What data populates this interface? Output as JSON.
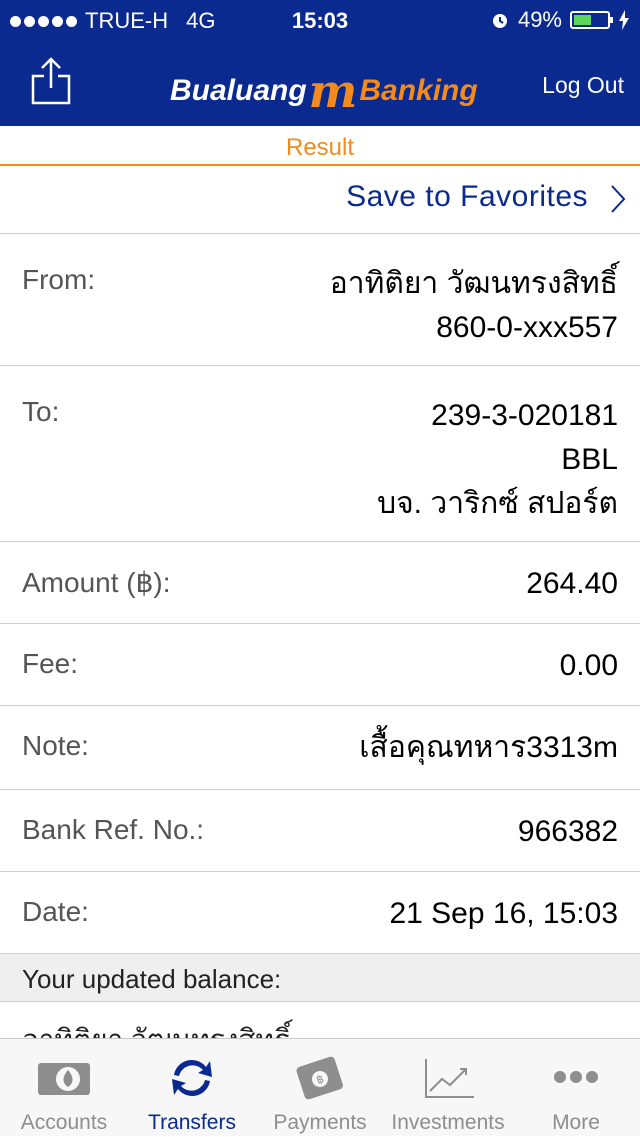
{
  "status_bar": {
    "carrier": "TRUE-H",
    "network": "4G",
    "time": "15:03",
    "battery": "49%"
  },
  "header": {
    "logo_part1": "Bualuang",
    "logo_m": "m",
    "logo_part2": "Banking",
    "logout_label": "Log Out"
  },
  "page_title": "Result",
  "favorites_label": "Save to Favorites",
  "details": [
    {
      "key": "From:",
      "lines": [
        "อาทิติยา วัฒนทรงสิทธิ์",
        "860-0-xxx557"
      ]
    },
    {
      "key": "To:",
      "lines": [
        "239-3-020181",
        "BBL",
        "บจ. วาริกซ์ สปอร์ต"
      ]
    },
    {
      "key": "Amount (฿):",
      "lines": [
        "264.40"
      ]
    },
    {
      "key": "Fee:",
      "lines": [
        "0.00"
      ]
    },
    {
      "key": "Note:",
      "lines": [
        "เสื้อคุณทหาร3313m"
      ]
    },
    {
      "key": "Bank Ref. No.:",
      "lines": [
        "966382"
      ]
    },
    {
      "key": "Date:",
      "lines": [
        "21 Sep 16, 15:03"
      ]
    }
  ],
  "balance": {
    "header": "Your updated balance:",
    "partial_name": "อาทิติยา วัฒนทรงสิทธิ์"
  },
  "tabs": [
    {
      "label": "Accounts",
      "icon": "accounts-icon",
      "active": false
    },
    {
      "label": "Transfers",
      "icon": "transfers-icon",
      "active": true
    },
    {
      "label": "Payments",
      "icon": "payments-icon",
      "active": false
    },
    {
      "label": "Investments",
      "icon": "investments-icon",
      "active": false
    },
    {
      "label": "More",
      "icon": "more-icon",
      "active": false
    }
  ],
  "colors": {
    "brand_blue": "#0a2a8f",
    "accent_orange": "#f28b1c"
  }
}
